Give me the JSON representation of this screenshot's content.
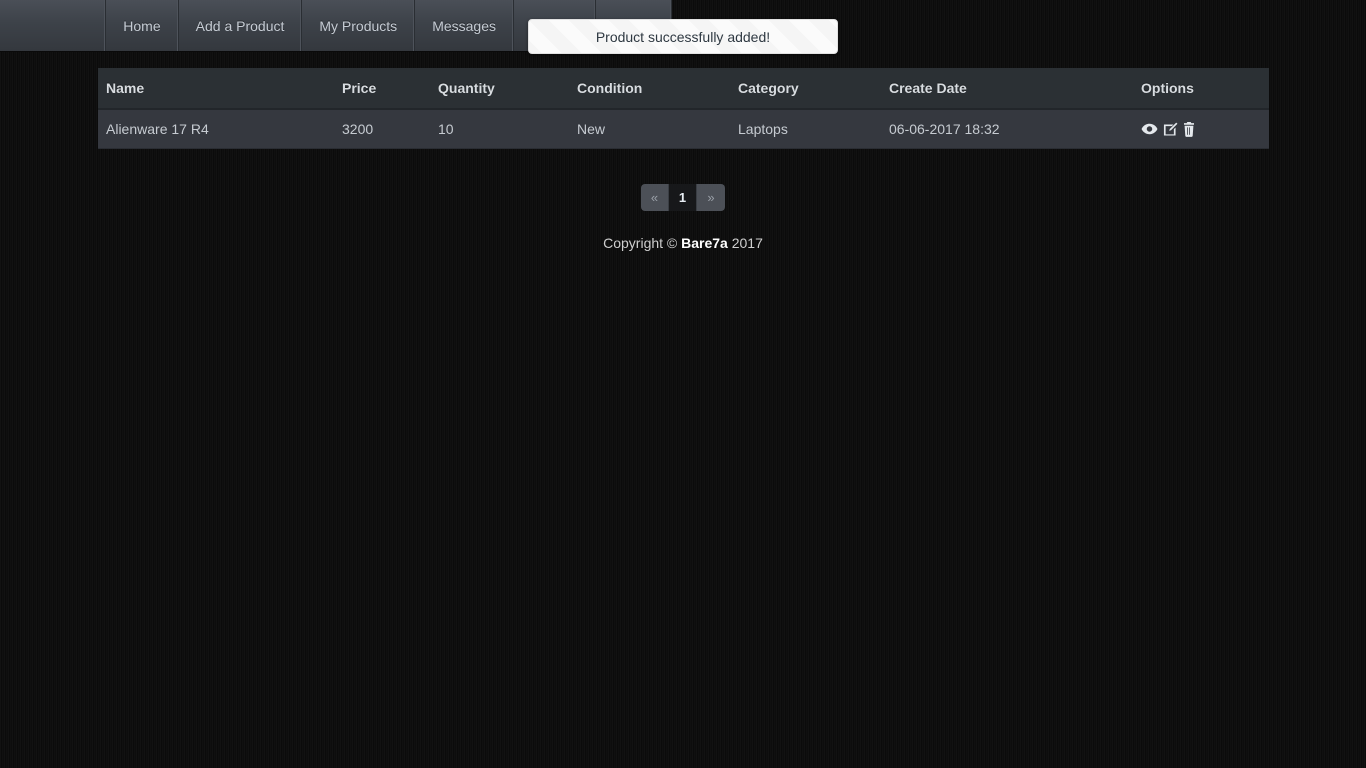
{
  "navbar": {
    "items": [
      {
        "label": "Home",
        "name": "nav-item-home"
      },
      {
        "label": "Add a Product",
        "name": "nav-item-add-a-product"
      },
      {
        "label": "My Products",
        "name": "nav-item-my-products"
      },
      {
        "label": "Messages",
        "name": "nav-item-messages"
      }
    ]
  },
  "alert": {
    "message": "Product successfully added!",
    "type": "success",
    "background": "#fbfbfb",
    "text_color": "#2f3942"
  },
  "table": {
    "headers": [
      "Name",
      "Price",
      "Quantity",
      "Condition",
      "Category",
      "Create Date",
      "Options"
    ],
    "rows": [
      {
        "name": "Alienware 17 R4",
        "price": "3200",
        "quantity": "10",
        "condition": "New",
        "category": "Laptops",
        "create_date": "06-06-2017 18:32",
        "options": [
          {
            "icon": "eye-icon",
            "label": "View"
          },
          {
            "icon": "pencil-square-icon",
            "label": "Edit"
          },
          {
            "icon": "trash-icon",
            "label": "Delete"
          }
        ]
      }
    ],
    "header_background": "#2b3034",
    "row_background": "#35383f"
  },
  "pagination": {
    "prev_label": "«",
    "next_label": "»",
    "pages": [
      {
        "label": "1",
        "active": true
      }
    ],
    "active_background": "#17181a"
  },
  "footer": {
    "prefix": "Copyright © ",
    "brand": "Bare7a",
    "suffix": " 2017"
  }
}
